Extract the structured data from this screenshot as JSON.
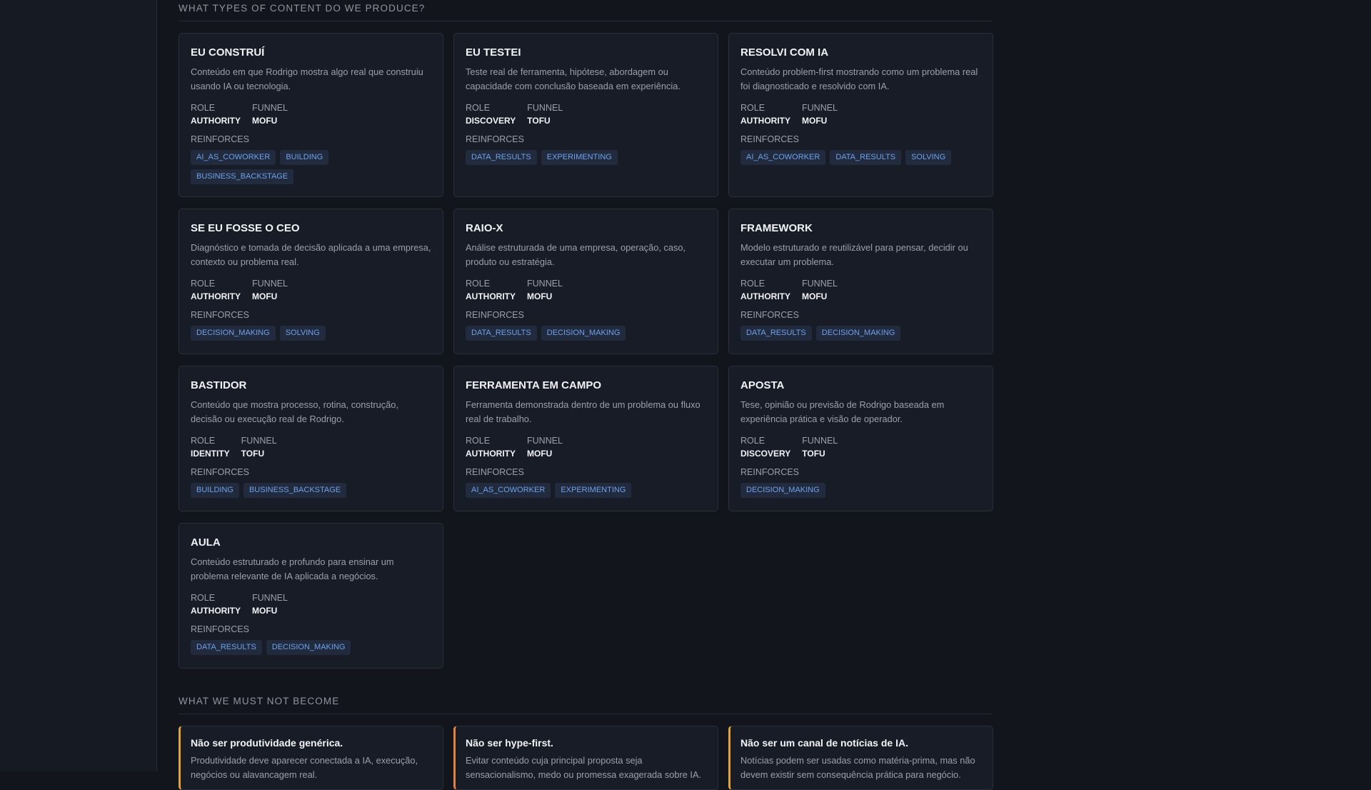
{
  "sections": {
    "content_types_title": "WHAT TYPES OF CONTENT DO WE PRODUCE?",
    "must_not_title": "WHAT WE MUST NOT BECOME"
  },
  "labels": {
    "role": "ROLE",
    "funnel": "FUNNEL",
    "reinforces": "REINFORCES"
  },
  "cards": [
    {
      "title": "EU CONSTRUÍ",
      "desc": "Conteúdo em que Rodrigo mostra algo real que construiu usando IA ou tecnologia.",
      "role": "AUTHORITY",
      "funnel": "MOFU",
      "tags": [
        "AI_AS_COWORKER",
        "BUILDING",
        "BUSINESS_BACKSTAGE"
      ]
    },
    {
      "title": "EU TESTEI",
      "desc": "Teste real de ferramenta, hipótese, abordagem ou capacidade com conclusão baseada em experiência.",
      "role": "DISCOVERY",
      "funnel": "TOFU",
      "tags": [
        "DATA_RESULTS",
        "EXPERIMENTING"
      ]
    },
    {
      "title": "RESOLVI COM IA",
      "desc": "Conteúdo problem-first mostrando como um problema real foi diagnosticado e resolvido com IA.",
      "role": "AUTHORITY",
      "funnel": "MOFU",
      "tags": [
        "AI_AS_COWORKER",
        "DATA_RESULTS",
        "SOLVING"
      ]
    },
    {
      "title": "SE EU FOSSE O CEO",
      "desc": "Diagnóstico e tomada de decisão aplicada a uma empresa, contexto ou problema real.",
      "role": "AUTHORITY",
      "funnel": "MOFU",
      "tags": [
        "DECISION_MAKING",
        "SOLVING"
      ]
    },
    {
      "title": "RAIO-X",
      "desc": "Análise estruturada de uma empresa, operação, caso, produto ou estratégia.",
      "role": "AUTHORITY",
      "funnel": "MOFU",
      "tags": [
        "DATA_RESULTS",
        "DECISION_MAKING"
      ]
    },
    {
      "title": "FRAMEWORK",
      "desc": "Modelo estruturado e reutilizável para pensar, decidir ou executar um problema.",
      "role": "AUTHORITY",
      "funnel": "MOFU",
      "tags": [
        "DATA_RESULTS",
        "DECISION_MAKING"
      ]
    },
    {
      "title": "BASTIDOR",
      "desc": "Conteúdo que mostra processo, rotina, construção, decisão ou execução real de Rodrigo.",
      "role": "IDENTITY",
      "funnel": "TOFU",
      "tags": [
        "BUILDING",
        "BUSINESS_BACKSTAGE"
      ]
    },
    {
      "title": "FERRAMENTA EM CAMPO",
      "desc": "Ferramenta demonstrada dentro de um problema ou fluxo real de trabalho.",
      "role": "AUTHORITY",
      "funnel": "MOFU",
      "tags": [
        "AI_AS_COWORKER",
        "EXPERIMENTING"
      ]
    },
    {
      "title": "APOSTA",
      "desc": "Tese, opinião ou previsão de Rodrigo baseada em experiência prática e visão de operador.",
      "role": "DISCOVERY",
      "funnel": "TOFU",
      "tags": [
        "DECISION_MAKING"
      ]
    },
    {
      "title": "AULA",
      "desc": "Conteúdo estruturado e profundo para ensinar um problema relevante de IA aplicada a negócios.",
      "role": "AUTHORITY",
      "funnel": "MOFU",
      "tags": [
        "DATA_RESULTS",
        "DECISION_MAKING"
      ]
    }
  ],
  "warnings": [
    {
      "title": "Não ser produtividade genérica.",
      "desc": "Produtividade deve aparecer conectada a IA, execução, negócios ou alavancagem real.",
      "accent": "#e0a33a"
    },
    {
      "title": "Não ser hype-first.",
      "desc": "Evitar conteúdo cuja principal proposta seja sensacionalismo, medo ou promessa exagerada sobre IA.",
      "accent": "#e4823a"
    },
    {
      "title": "Não ser um canal de notícias de IA.",
      "desc": "Notícias podem ser usadas como matéria-prima, mas não devem existir sem consequência prática para negócio.",
      "accent": "#e0a33a"
    }
  ]
}
